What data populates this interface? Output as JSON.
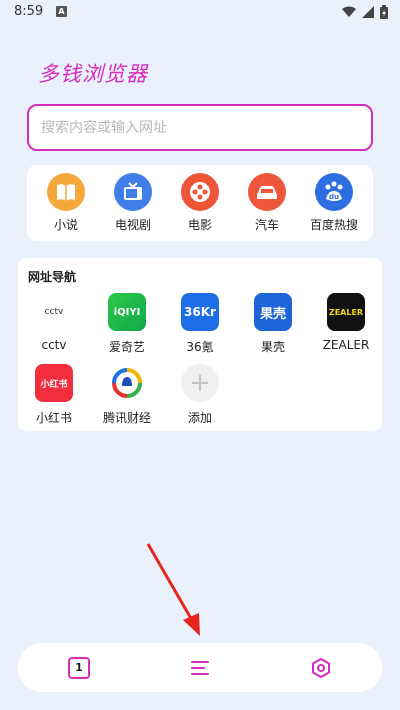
{
  "status_bar": {
    "time": "8:59",
    "notif_letter": "A"
  },
  "app": {
    "title": "多钱浏览器",
    "accent": "#d62bbd"
  },
  "search": {
    "placeholder": "搜索内容或输入网址",
    "value": ""
  },
  "quick_links": [
    {
      "label": "小说",
      "icon": "book-icon",
      "color": "#f6a93b"
    },
    {
      "label": "电视剧",
      "icon": "tv-icon",
      "color": "#3f7ee8"
    },
    {
      "label": "电影",
      "icon": "film-reel-icon",
      "color": "#f0563a"
    },
    {
      "label": "汽车",
      "icon": "car-icon",
      "color": "#f0563a"
    },
    {
      "label": "百度热搜",
      "icon": "baidu-paw-icon",
      "color": "#2d6fe0"
    }
  ],
  "site_nav": {
    "title": "网址导航",
    "sites": [
      {
        "label": "cctv",
        "logo_text": "cctv",
        "icon": "cctv-logo-icon"
      },
      {
        "label": "爱奇艺",
        "logo_text": "iQIYI",
        "icon": "iqiyi-logo-icon"
      },
      {
        "label": "36氪",
        "logo_text": "36Kr",
        "icon": "36kr-logo-icon"
      },
      {
        "label": "果壳",
        "logo_text": "果壳",
        "icon": "guokr-logo-icon"
      },
      {
        "label": "ZEALER",
        "logo_text": "ZEALER",
        "icon": "zealer-logo-icon"
      },
      {
        "label": "小红书",
        "logo_text": "小红书",
        "icon": "xiaohongshu-logo-icon"
      },
      {
        "label": "腾讯财经",
        "logo_text": "",
        "icon": "tencent-finance-logo-icon"
      },
      {
        "label": "添加",
        "logo_text": "+",
        "icon": "add-icon"
      }
    ]
  },
  "bottom_bar": {
    "tab_count": "1",
    "menu_icon": "menu-icon",
    "settings_icon": "hexagon-settings-icon"
  }
}
